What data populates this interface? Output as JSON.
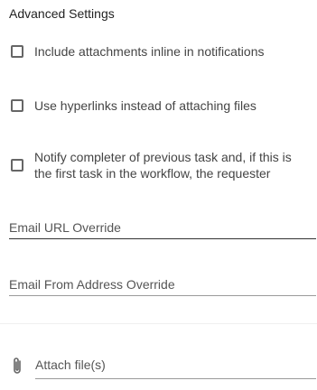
{
  "section": {
    "title": "Advanced Settings"
  },
  "options": [
    {
      "label": "Include attachments inline in notifications",
      "checked": false
    },
    {
      "label": "Use hyperlinks instead of attaching files",
      "checked": false
    },
    {
      "label": "Notify completer of previous task and, if this is the first task in the workflow, the requester",
      "checked": false
    }
  ],
  "fields": {
    "email_url_override": {
      "placeholder": "Email URL Override",
      "value": ""
    },
    "email_from_override": {
      "placeholder": "Email From Address Override",
      "value": ""
    }
  },
  "attachments": {
    "label": "Attach file(s)",
    "icon": "paperclip-icon"
  },
  "colors": {
    "text": "#444444",
    "checkbox_border": "#666666",
    "underline_active": "#333333",
    "underline_default": "#9a9a9a"
  }
}
